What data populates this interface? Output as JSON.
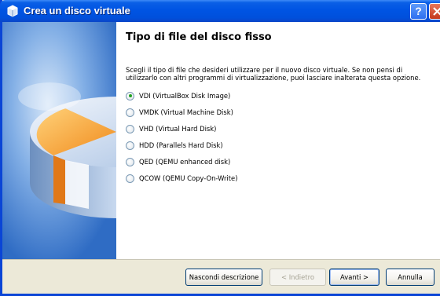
{
  "window": {
    "title": "Crea un disco virtuale",
    "help_label": "?"
  },
  "page": {
    "heading": "Tipo di file del disco fisso",
    "description": "Scegli il tipo di file che desideri utilizzare per il nuovo disco virtuale. Se non pensi di utilizzarlo con altri programmi di virtualizzazione, puoi lasciare inalterata questa opzione."
  },
  "options": [
    {
      "label": "VDI (VirtualBox Disk Image)",
      "checked": true
    },
    {
      "label": "VMDK (Virtual Machine Disk)",
      "checked": false
    },
    {
      "label": "VHD (Virtual Hard Disk)",
      "checked": false
    },
    {
      "label": "HDD (Parallels Hard Disk)",
      "checked": false
    },
    {
      "label": "QED (QEMU enhanced disk)",
      "checked": false
    },
    {
      "label": "QCOW (QEMU Copy-On-Write)",
      "checked": false
    }
  ],
  "buttons": {
    "hide_description": "Nascondi descrizione",
    "back": "< Indietro",
    "next": "Avanti >",
    "cancel": "Annulla"
  },
  "colors": {
    "titlebar": "#0054e3",
    "selected_radio": "#21a121"
  }
}
